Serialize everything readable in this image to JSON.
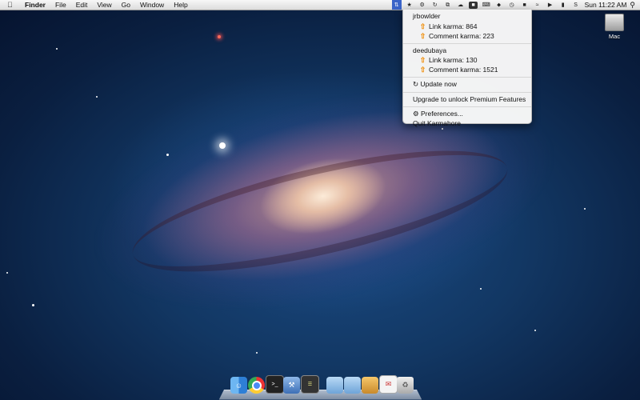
{
  "menubar": {
    "apple_icon": "apple-icon",
    "menus": [
      "Finder",
      "File",
      "Edit",
      "View",
      "Go",
      "Window",
      "Help"
    ],
    "clock": "Sun 11:22 AM"
  },
  "dropdown": {
    "accounts": [
      {
        "username": "jrbowlder",
        "link_karma": "Link karma: 864",
        "comment_karma": "Comment karma: 223"
      },
      {
        "username": "deedubaya",
        "link_karma": "Link karma: 130",
        "comment_karma": "Comment karma: 1521"
      }
    ],
    "update_now": "Update now",
    "upgrade": "Upgrade to unlock Premium Features",
    "preferences": "Preferences...",
    "quit": "Quit Karmahore"
  },
  "desktop": {
    "hard_drive_label": "Mac"
  },
  "colors": {
    "menu_highlight": "#3b64c8",
    "karma_arrow": "#f08a00"
  }
}
